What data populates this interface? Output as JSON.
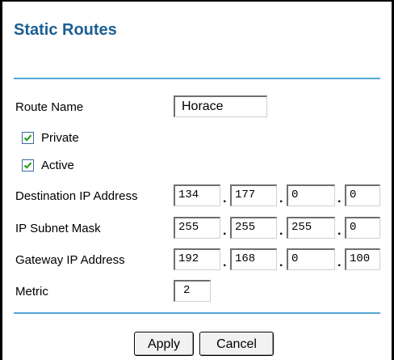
{
  "page": {
    "title": "Static Routes",
    "accent_color": "#1b5f93",
    "divider_color": "#58a6d4"
  },
  "form": {
    "route_name": {
      "label": "Route Name",
      "value": "Horace"
    },
    "private": {
      "label": "Private",
      "checked": true
    },
    "active": {
      "label": "Active",
      "checked": true
    },
    "destination_ip": {
      "label": "Destination IP Address",
      "octets": [
        "134",
        "177",
        "0",
        "0"
      ]
    },
    "subnet_mask": {
      "label": "IP Subnet Mask",
      "octets": [
        "255",
        "255",
        "255",
        "0"
      ]
    },
    "gateway_ip": {
      "label": "Gateway IP Address",
      "octets": [
        "192",
        "168",
        "0",
        "100"
      ]
    },
    "metric": {
      "label": "Metric",
      "value": "2"
    },
    "separator": "."
  },
  "buttons": {
    "apply": "Apply",
    "cancel": "Cancel"
  }
}
